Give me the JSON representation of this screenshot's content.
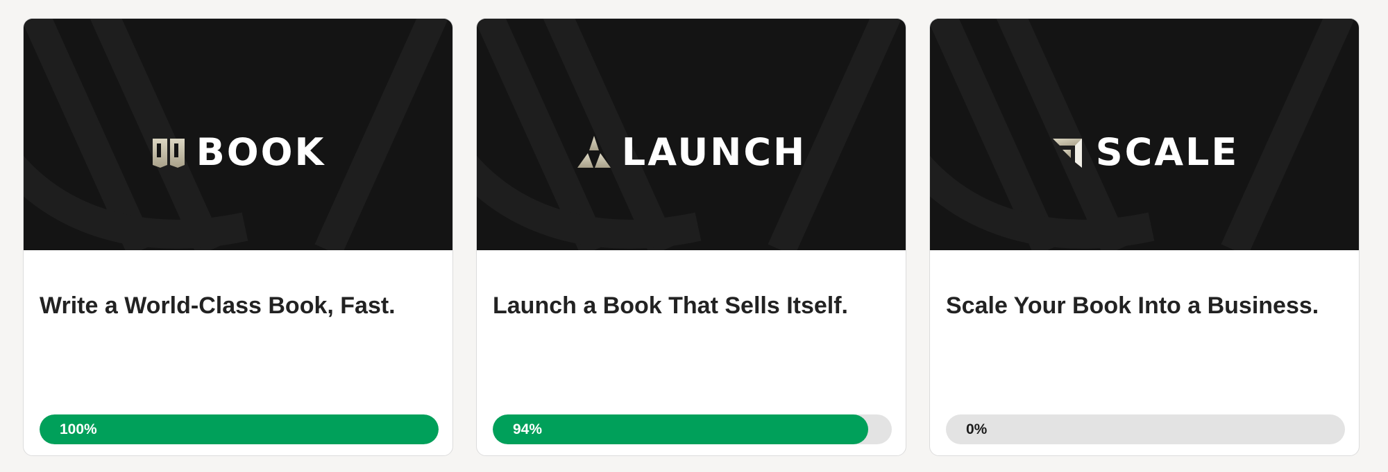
{
  "colors": {
    "page_background": "#f6f5f3",
    "banner_background": "#141414",
    "progress_fill": "#00a05a",
    "progress_track": "#e3e3e3",
    "logo_gold": "#c9c3ad",
    "title_text": "#222222"
  },
  "cards": [
    {
      "brand": "BOOK",
      "logo_icon": "book-icon",
      "title": "Write a World-Class Book, Fast.",
      "progress": 100,
      "progress_label": "100%"
    },
    {
      "brand": "LAUNCH",
      "logo_icon": "triangle-peaks-icon",
      "title": "Launch a Book That Sells Itself.",
      "progress": 94,
      "progress_label": "94%"
    },
    {
      "brand": "SCALE",
      "logo_icon": "arrow-up-right-icon",
      "title": "Scale Your Book Into a Business.",
      "progress": 0,
      "progress_label": "0%"
    }
  ]
}
